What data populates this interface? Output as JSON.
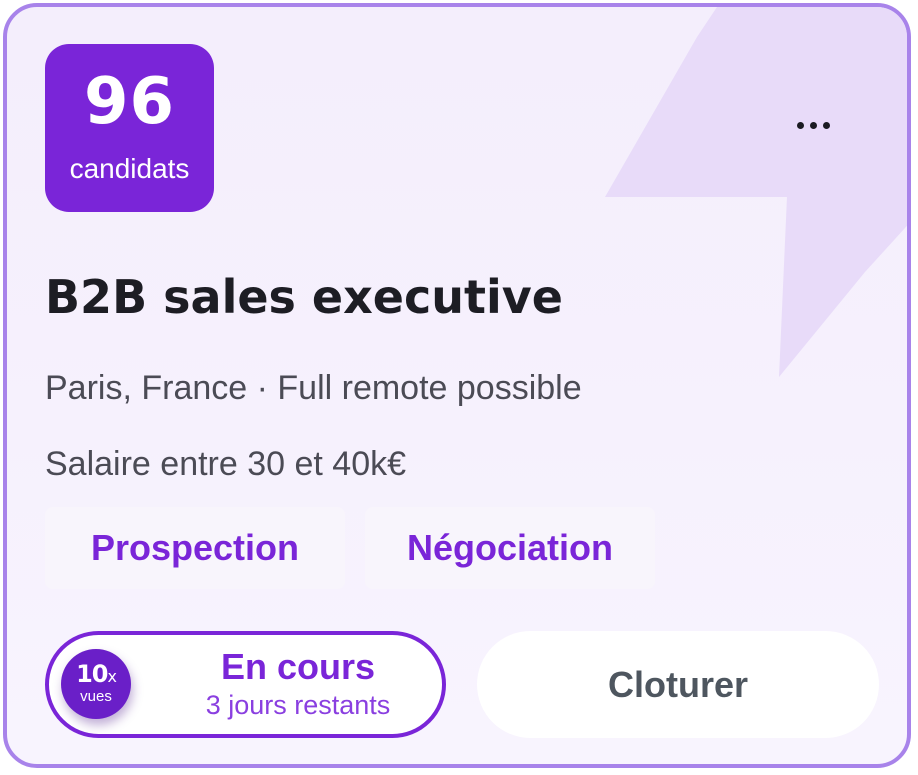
{
  "card": {
    "candidates": {
      "count": "96",
      "label": "candidats"
    },
    "title": "B2B sales executive",
    "location_line": "Paris, France · Full remote possible",
    "salary_line": "Salaire entre 30 et 40k€",
    "tags": [
      {
        "label": "Prospection"
      },
      {
        "label": "Négociation"
      }
    ],
    "status": {
      "views_count": "10",
      "views_suffix": "x",
      "views_label": "vues",
      "label": "En cours",
      "remaining": "3 jours restants"
    },
    "close_label": "Cloturer",
    "more_icon": "more-horizontal-icon",
    "background_icon": "lightning-bolt-icon"
  },
  "colors": {
    "accent": "#7a25d8",
    "card_border": "#a883ea",
    "text_dark": "#1d1d24",
    "text_muted": "#4b4b55"
  }
}
